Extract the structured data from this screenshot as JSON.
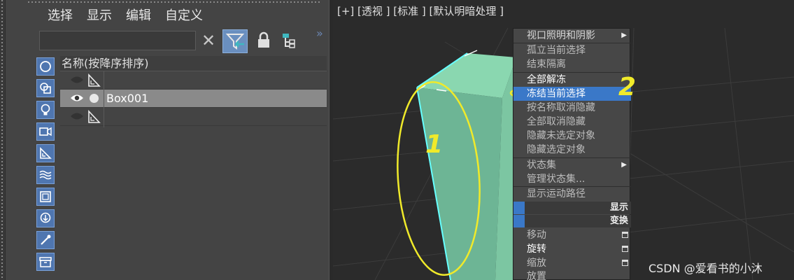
{
  "explorer": {
    "menu": [
      "选择",
      "显示",
      "编辑",
      "自定义"
    ],
    "search": {
      "value": "",
      "placeholder": ""
    },
    "tree_header": "名称(按降序排序)",
    "rows": [
      {
        "name": ""
      },
      {
        "name": "Box001"
      },
      {
        "name": ""
      }
    ]
  },
  "viewport": {
    "label": "[+] [透视 ] [标准 ] [默认明暗处理 ]"
  },
  "quad_menu": {
    "items": [
      "视口照明和阴影",
      "孤立当前选择",
      "结束隔离",
      "全部解冻",
      "冻结当前选择",
      "按名称取消隐藏",
      "全部取消隐藏",
      "隐藏未选定对象",
      "隐藏选定对象",
      "状态集",
      "管理状态集...",
      "显示运动路径",
      "移动",
      "旋转",
      "缩放",
      "放置"
    ],
    "headers": [
      "显示",
      "变换"
    ]
  },
  "annotations": {
    "one": "1",
    "two": "2"
  },
  "watermark": "CSDN @爱看书的小沐",
  "colors": {
    "highlight": "#3a78c8",
    "box_face": "#6db595",
    "annotation": "#f0ea2a"
  }
}
